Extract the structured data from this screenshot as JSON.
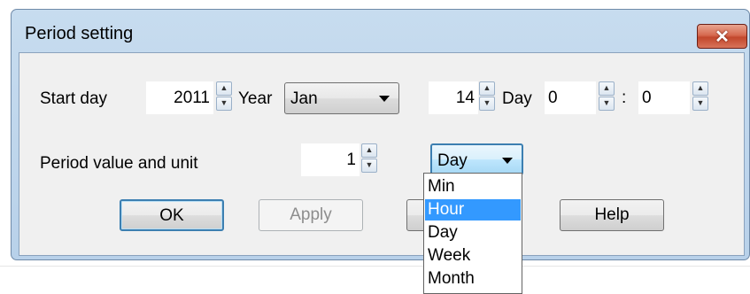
{
  "window": {
    "title": "Period setting",
    "close_label": "✕"
  },
  "start": {
    "label": "Start day",
    "year_value": "2011",
    "year_label": "Year",
    "month_value": "Jan",
    "day_value": "14",
    "day_label": "Day",
    "hour_value": "0",
    "time_separator": ":",
    "minute_value": "0"
  },
  "period": {
    "label": "Period value and unit",
    "value": "1",
    "unit_value": "Day"
  },
  "buttons": {
    "ok": "OK",
    "apply": "Apply",
    "help": "Help"
  },
  "unit_dropdown": {
    "options": [
      "Min",
      "Hour",
      "Day",
      "Week",
      "Month"
    ],
    "highlighted": "Hour"
  },
  "colors": {
    "title_bar": "#c7dcef",
    "close_button": "#c2472c",
    "highlight": "#3399ff"
  }
}
